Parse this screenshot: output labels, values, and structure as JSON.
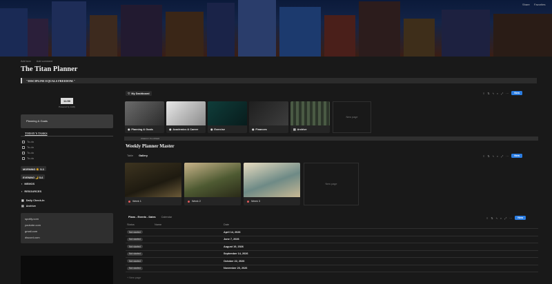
{
  "window_controls": [
    "Share",
    "Favorites"
  ],
  "page_meta": [
    "Add icon",
    "Add comment"
  ],
  "title": "The Titan Planner",
  "quote": "\"DISCIPLINE EQUALS FREEDOM.\"",
  "widget": {
    "clock": "11:50",
    "caption": "Powered by Indify"
  },
  "nav_card": "Planning & Goals",
  "todays_tasks": {
    "heading": "TODAY'S TASKS",
    "items": [
      "To-do",
      "To-do",
      "To-do",
      "To-do"
    ]
  },
  "pills": [
    "MORNING ☀️ 5-3",
    "EVENING 🌙 5-6"
  ],
  "pages": [
    "MEMOS",
    "RESOURCES",
    "Daily Check-In",
    "Archive"
  ],
  "links": [
    "spotify.com",
    "youtube.com",
    "gmail.com",
    "discord.com"
  ],
  "dashboard": {
    "tab": "My Dashboard",
    "new_button": "New",
    "cards": [
      "Planning & Goals",
      "Academics & Career",
      "Exercise",
      "Finances",
      "Archive"
    ],
    "new_page": "New page"
  },
  "weekly": {
    "bar": "WEEKLY PLANNER",
    "title": "Weekly Planner Master",
    "tabs": [
      "Table",
      "Gallery"
    ],
    "new_button": "New",
    "cards": [
      "Week 1",
      "Week 2",
      "Week 3"
    ],
    "new_page": "New page"
  },
  "events": {
    "tabs": [
      "Plans - Events - Dates",
      "Calendar"
    ],
    "new_button": "New",
    "columns": [
      "Status",
      "Name",
      "Date"
    ],
    "rows": [
      {
        "status": "Not started",
        "date": "April 14, 2026"
      },
      {
        "status": "Not started",
        "date": "June 7, 2026"
      },
      {
        "status": "Not started",
        "date": "August 19, 2026"
      },
      {
        "status": "Not started",
        "date": "September 14, 2026"
      },
      {
        "status": "Not started",
        "date": "October 22, 2026"
      },
      {
        "status": "Not started",
        "date": "November 20, 2026"
      }
    ],
    "new_page": "+ New page"
  },
  "colors": {
    "accent": "#2b7de2",
    "background": "#191919"
  }
}
